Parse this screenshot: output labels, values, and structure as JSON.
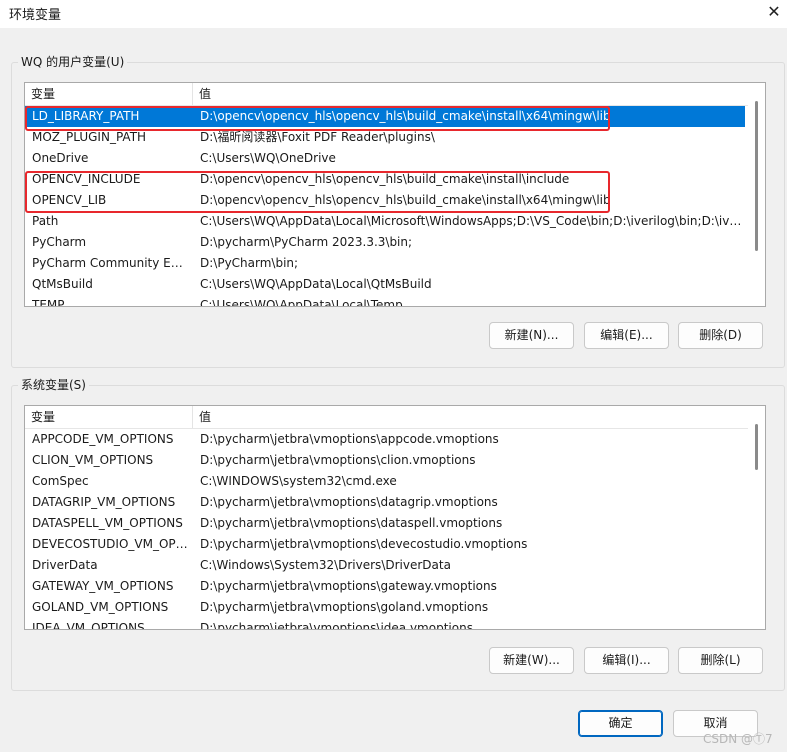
{
  "window": {
    "title": "环境变量",
    "close_glyph": "✕"
  },
  "user_vars": {
    "legend": "WQ 的用户变量(U)",
    "header": {
      "name": "变量",
      "value": "值"
    },
    "rows": [
      {
        "name": "LD_LIBRARY_PATH",
        "value": "D:\\opencv\\opencv_hls\\opencv_hls\\build_cmake\\install\\x64\\mingw\\lib",
        "selected": true
      },
      {
        "name": "MOZ_PLUGIN_PATH",
        "value": "D:\\福昕阅读器\\Foxit PDF Reader\\plugins\\"
      },
      {
        "name": "OneDrive",
        "value": "C:\\Users\\WQ\\OneDrive"
      },
      {
        "name": "OPENCV_INCLUDE",
        "value": "D:\\opencv\\opencv_hls\\opencv_hls\\build_cmake\\install\\include"
      },
      {
        "name": "OPENCV_LIB",
        "value": "D:\\opencv\\opencv_hls\\opencv_hls\\build_cmake\\install\\x64\\mingw\\lib"
      },
      {
        "name": "Path",
        "value": "C:\\Users\\WQ\\AppData\\Local\\Microsoft\\WindowsApps;D:\\VS_Code\\bin;D:\\iverilog\\bin;D:\\ive..."
      },
      {
        "name": "PyCharm",
        "value": "D:\\pycharm\\PyCharm 2023.3.3\\bin;"
      },
      {
        "name": "PyCharm Community Editi...",
        "value": "D:\\PyCharm\\bin;"
      },
      {
        "name": "QtMsBuild",
        "value": "C:\\Users\\WQ\\AppData\\Local\\QtMsBuild"
      },
      {
        "name": "TEMP",
        "value": "C:\\Users\\WQ\\AppData\\Local\\Temp"
      }
    ],
    "buttons": {
      "new": "新建(N)...",
      "edit": "编辑(E)...",
      "delete": "删除(D)"
    }
  },
  "system_vars": {
    "legend": "系统变量(S)",
    "header": {
      "name": "变量",
      "value": "值"
    },
    "rows": [
      {
        "name": "APPCODE_VM_OPTIONS",
        "value": "D:\\pycharm\\jetbra\\vmoptions\\appcode.vmoptions"
      },
      {
        "name": "CLION_VM_OPTIONS",
        "value": "D:\\pycharm\\jetbra\\vmoptions\\clion.vmoptions"
      },
      {
        "name": "ComSpec",
        "value": "C:\\WINDOWS\\system32\\cmd.exe"
      },
      {
        "name": "DATAGRIP_VM_OPTIONS",
        "value": "D:\\pycharm\\jetbra\\vmoptions\\datagrip.vmoptions"
      },
      {
        "name": "DATASPELL_VM_OPTIONS",
        "value": "D:\\pycharm\\jetbra\\vmoptions\\dataspell.vmoptions"
      },
      {
        "name": "DEVECOSTUDIO_VM_OPT...",
        "value": "D:\\pycharm\\jetbra\\vmoptions\\devecostudio.vmoptions"
      },
      {
        "name": "DriverData",
        "value": "C:\\Windows\\System32\\Drivers\\DriverData"
      },
      {
        "name": "GATEWAY_VM_OPTIONS",
        "value": "D:\\pycharm\\jetbra\\vmoptions\\gateway.vmoptions"
      },
      {
        "name": "GOLAND_VM_OPTIONS",
        "value": "D:\\pycharm\\jetbra\\vmoptions\\goland.vmoptions"
      },
      {
        "name": "IDEA_VM_OPTIONS",
        "value": "D:\\pycharm\\jetbra\\vmoptions\\idea.vmoptions"
      }
    ],
    "buttons": {
      "new": "新建(W)...",
      "edit": "编辑(I)...",
      "delete": "删除(L)"
    }
  },
  "footer": {
    "ok": "确定",
    "cancel": "取消"
  },
  "watermark": "CSDN @Ⓣ7"
}
